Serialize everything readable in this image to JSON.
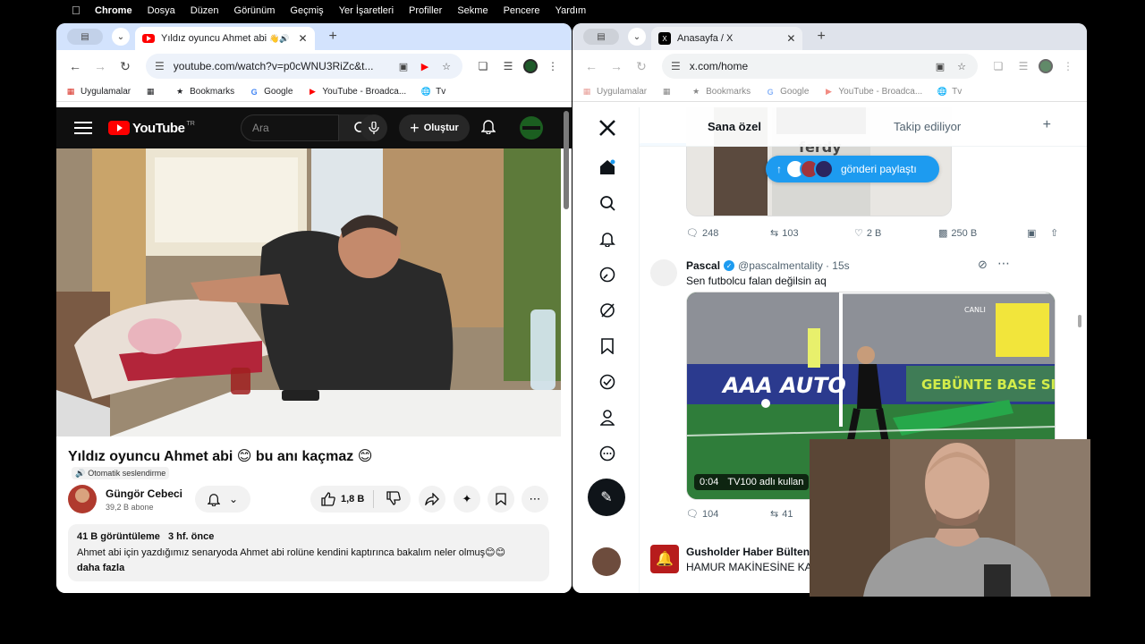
{
  "menubar": {
    "app": "Chrome",
    "items": [
      "Dosya",
      "Düzen",
      "Görünüm",
      "Geçmiş",
      "Yer İşaretleri",
      "Profiller",
      "Sekme",
      "Pencere",
      "Yardım"
    ]
  },
  "left_window": {
    "tab_title": "Yıldız oyuncu Ahmet abi",
    "url": "youtube.com/watch?v=p0cWNU3RiZc&t...",
    "bookmarks": [
      "Uygulamalar",
      "Bookmarks",
      "Google",
      "YouTube - Broadca...",
      "Tv"
    ]
  },
  "youtube": {
    "search_placeholder": "Ara",
    "create_label": "Oluştur",
    "logo_suffix": "TR",
    "video_title": "Yıldız oyuncu Ahmet abi 😊 bu anı kaçmaz 😊",
    "dub_label": "Otomatik seslendirme",
    "channel_name": "Güngör Cebeci",
    "channel_subs": "39,2 B abone",
    "likes": "1,8 B",
    "views": "41 B görüntüleme",
    "ago": "3 hf. önce",
    "description": "Ahmet abi için yazdığımız senaryoda Ahmet abi rolüne kendini kaptırınca bakalım neler olmuş😊😊",
    "more": "daha fazla"
  },
  "right_window": {
    "tab_title": "Anasayfa / X",
    "url": "x.com/home",
    "bookmarks": [
      "Uygulamalar",
      "Bookmarks",
      "Google",
      "YouTube - Broadca...",
      "Tv"
    ]
  },
  "x": {
    "tab_for_you": "Sana özel",
    "tab_following": "Takip ediliyor",
    "new_posts_pill": "gönderi paylaştı",
    "post1": {
      "replies": "248",
      "reposts": "103",
      "likes": "2 B",
      "views": "250 B"
    },
    "post2": {
      "name": "Pascal",
      "handle": "@pascalmentality",
      "time": "· 15s",
      "text": "Sen futbolcu falan değilsin aq",
      "duration": "0:04",
      "source": "TV100 adlı kullan",
      "replies": "104",
      "reposts": "41",
      "board_left": "AAA AUTO",
      "board_right": "GEBÜNTE BASE SIRE"
    },
    "post3": {
      "name": "Gusholder Haber Bülten",
      "text": "HAMUR MAKİNESİNE KAP"
    }
  }
}
